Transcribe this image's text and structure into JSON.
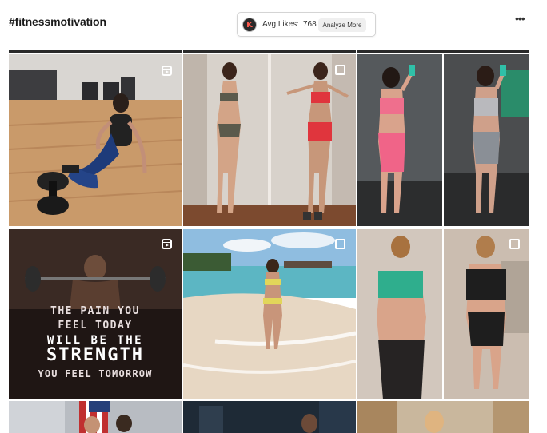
{
  "header": {
    "hashtag": "#fitnessmotivation",
    "avatar_letter": "K",
    "avg_likes_label": "Avg Likes:",
    "avg_likes_value": "768",
    "analyze_button": "Analyze More",
    "more_icon": "ellipsis-icon"
  },
  "posts": [
    {
      "id": 1,
      "badge": "reel-icon"
    },
    {
      "id": 2,
      "badge": "square-icon"
    },
    {
      "id": 3,
      "badge": "none"
    },
    {
      "id": 4,
      "badge": "reel-icon",
      "overlay_text": [
        "THE PAIN YOU",
        "FEEL TODAY",
        "WILL BE THE",
        "STRENGTH",
        "YOU FEEL TOMORROW"
      ]
    },
    {
      "id": 5,
      "badge": "square-icon"
    },
    {
      "id": 6,
      "badge": "square-icon"
    },
    {
      "id": 7,
      "badge": "none"
    },
    {
      "id": 8,
      "badge": "none"
    },
    {
      "id": 9,
      "badge": "none"
    }
  ],
  "colors": {
    "text": "#1b1b1b",
    "box_border": "#d4d4d4",
    "button_bg": "#efefef"
  }
}
